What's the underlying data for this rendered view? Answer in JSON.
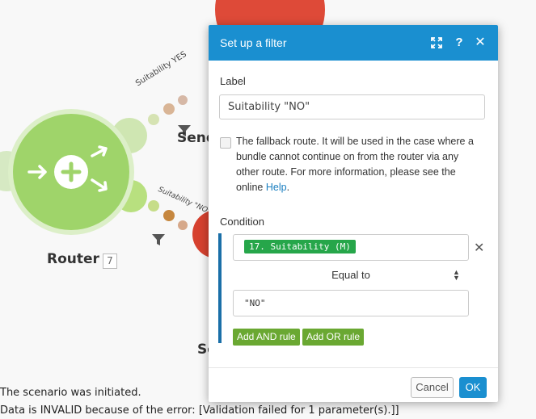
{
  "canvas": {
    "router_label": "Router",
    "router_id": "7",
    "send_label": "Send",
    "se_label": "Se",
    "route_yes_label": "Suitability YES",
    "route_no_label": "Suitability \"NO\""
  },
  "log": {
    "line1": "The scenario was initiated.",
    "line2": "Data is INVALID because of the error: [Validation failed for 1 parameter(s).]]"
  },
  "dialog": {
    "title": "Set up a filter",
    "label_caption": "Label",
    "label_value": "Suitability \"NO\"",
    "fallback_text": "The fallback route. It will be used in the case where a bundle cannot continue on from the router via any other route. For more information, please see the online",
    "fallback_link": "Help",
    "fallback_end": ".",
    "condition_caption": "Condition",
    "condition_field": "17. Suitability (M)",
    "operator": "Equal to",
    "condition_value": "\"NO\"",
    "add_and": "Add AND rule",
    "add_or": "Add OR rule",
    "cancel": "Cancel",
    "ok": "OK"
  },
  "colors": {
    "header": "#1a8fd0",
    "router": "#9fd46a",
    "module_red": "#de4a38",
    "pill": "#26a64a",
    "rule_button": "#6aa832"
  }
}
